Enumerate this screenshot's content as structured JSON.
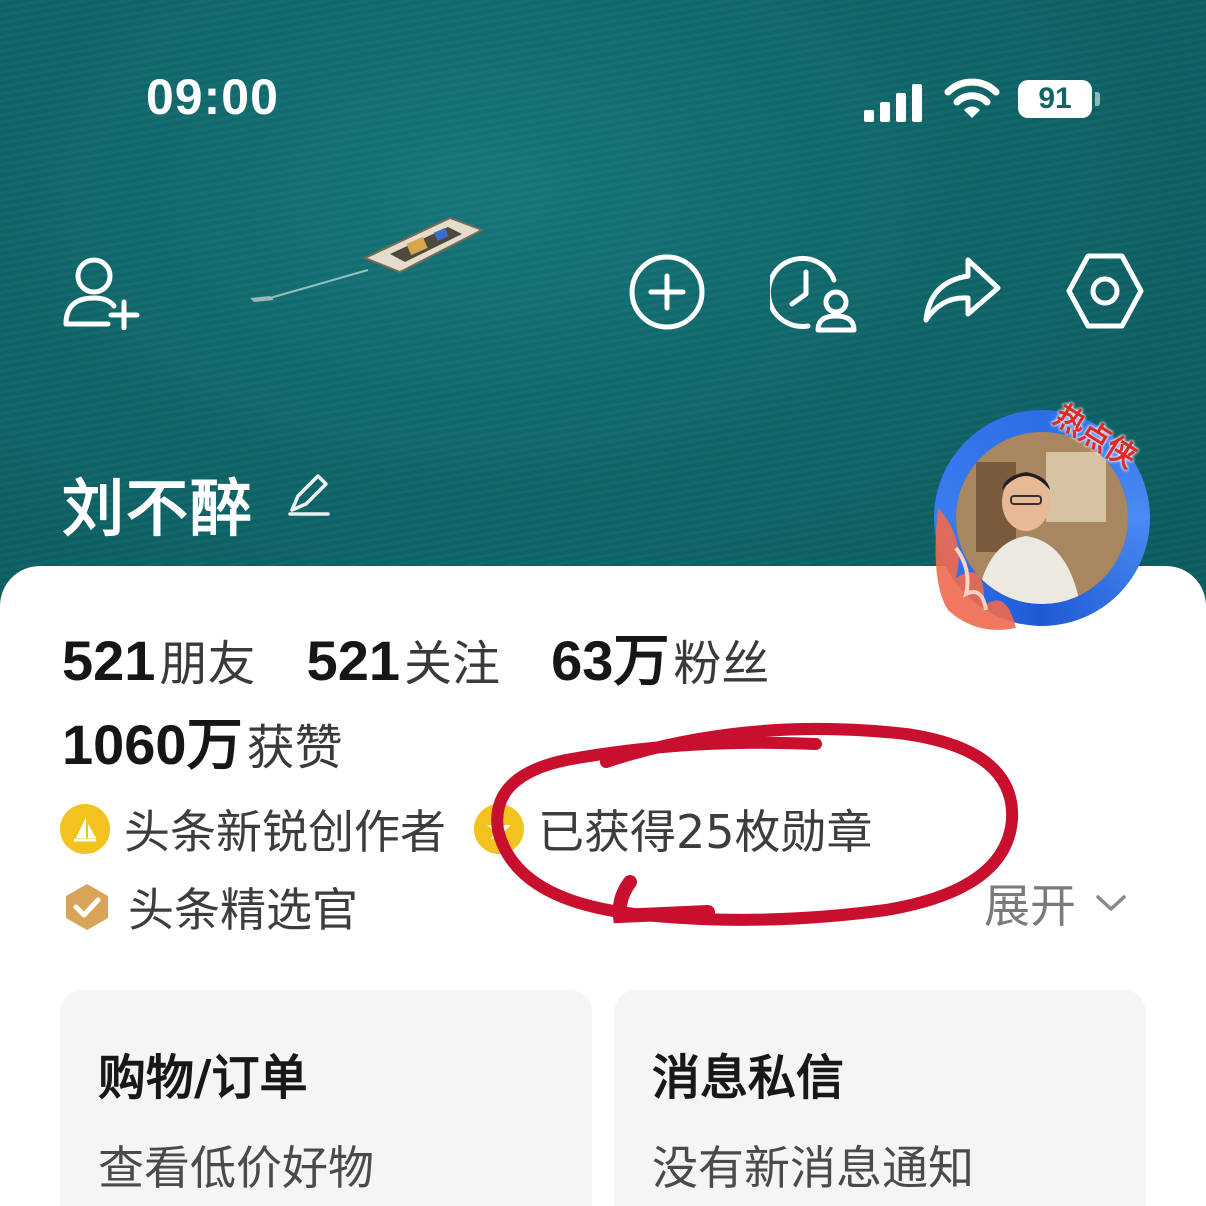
{
  "status_bar": {
    "time": "09:00",
    "battery": "91"
  },
  "header_icons": {
    "add_friend": "add-friend-icon",
    "create": "plus-circle-icon",
    "history": "history-icon",
    "share": "share-icon",
    "settings": "settings-icon"
  },
  "profile": {
    "name": "刘不醉",
    "avatar_badge": "热点侠"
  },
  "stats": [
    {
      "value": "521",
      "label": "朋友"
    },
    {
      "value": "521",
      "label": "关注"
    },
    {
      "value": "63万",
      "label": "粉丝"
    }
  ],
  "likes": {
    "value": "1060万",
    "label": "获赞"
  },
  "badges": {
    "creator": "头条新锐创作者",
    "medals": "已获得25枚勋章",
    "curator": "头条精选官",
    "expand": "展开"
  },
  "tiles": [
    {
      "title": "购物/订单",
      "subtitle": "查看低价好物"
    },
    {
      "title": "消息私信",
      "subtitle": "没有新消息通知"
    }
  ],
  "colors": {
    "hero_teal": "#0f6669",
    "annotation_red": "#c8102e",
    "badge_gold": "#f2c21e",
    "curator_gold": "#d9a35a"
  }
}
